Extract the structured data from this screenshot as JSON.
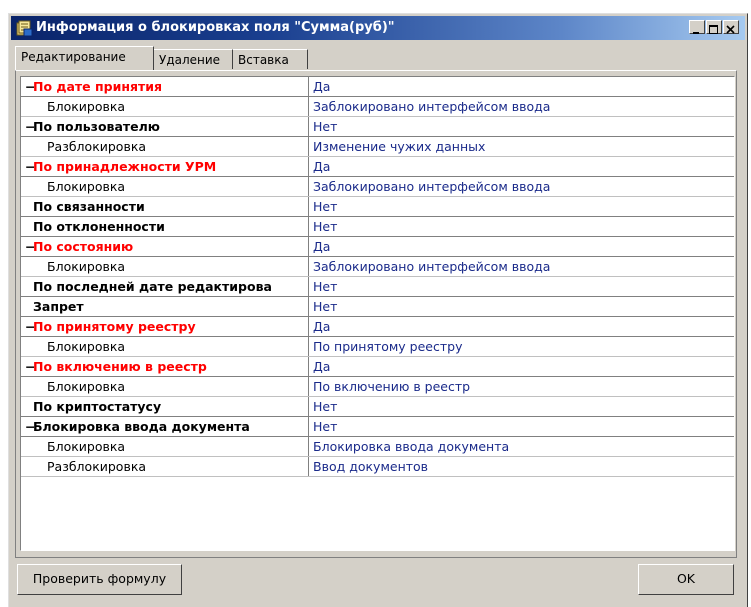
{
  "window": {
    "title": "Информация о блокировках поля \"Сумма(руб)\"",
    "colors": {
      "titlebar_start": "#0a246a",
      "titlebar_end": "#a6caf0",
      "face": "#d4d0c8",
      "red": "#ff0000",
      "value_blue": "#1a2a8a"
    }
  },
  "tabs": [
    "Редактирование",
    "Удаление",
    "Вставка"
  ],
  "active_tab": "Редактирование",
  "rows": [
    {
      "name": "По дате принятия",
      "value": "Да",
      "style": "red",
      "toggle": "−",
      "type": "group"
    },
    {
      "name": "Блокировка",
      "value": "Заблокировано интерфейсом ввода",
      "type": "sub"
    },
    {
      "name": "По пользователю",
      "value": "Нет",
      "style": "black",
      "toggle": "−",
      "type": "group"
    },
    {
      "name": "Разблокировка",
      "value": "Изменение чужих данных",
      "type": "sub"
    },
    {
      "name": "По принадлежности УРМ",
      "value": "Да",
      "style": "red",
      "toggle": "−",
      "type": "group"
    },
    {
      "name": "Блокировка",
      "value": "Заблокировано интерфейсом ввода",
      "type": "sub"
    },
    {
      "name": "По связанности",
      "value": "Нет",
      "style": "black",
      "toggle": "",
      "type": "group"
    },
    {
      "name": "По отклоненности",
      "value": "Нет",
      "style": "black",
      "toggle": "",
      "type": "group"
    },
    {
      "name": "По состоянию",
      "value": "Да",
      "style": "red",
      "toggle": "−",
      "type": "group"
    },
    {
      "name": "Блокировка",
      "value": "Заблокировано интерфейсом ввода",
      "type": "sub"
    },
    {
      "name": "По последней дате редактирова",
      "value": "Нет",
      "style": "black",
      "toggle": "",
      "type": "group"
    },
    {
      "name": "Запрет",
      "value": "Нет",
      "style": "black",
      "toggle": "",
      "type": "group"
    },
    {
      "name": "По принятому реестру",
      "value": "Да",
      "style": "red",
      "toggle": "−",
      "type": "group"
    },
    {
      "name": "Блокировка",
      "value": "По принятому реестру",
      "type": "sub"
    },
    {
      "name": "По включению в реестр",
      "value": "Да",
      "style": "red",
      "toggle": "−",
      "type": "group"
    },
    {
      "name": "Блокировка",
      "value": "По включению в реестр",
      "type": "sub"
    },
    {
      "name": "По криптостатусу",
      "value": "Нет",
      "style": "black",
      "toggle": "",
      "type": "group"
    },
    {
      "name": "Блокировка ввода документа",
      "value": "Нет",
      "style": "black",
      "toggle": "−",
      "type": "group"
    },
    {
      "name": "Блокировка",
      "value": "Блокировка ввода документа",
      "type": "sub"
    },
    {
      "name": "Разблокировка",
      "value": "Ввод документов",
      "type": "sub"
    }
  ],
  "buttons": {
    "check_formula": "Проверить формулу",
    "ok": "OK"
  }
}
